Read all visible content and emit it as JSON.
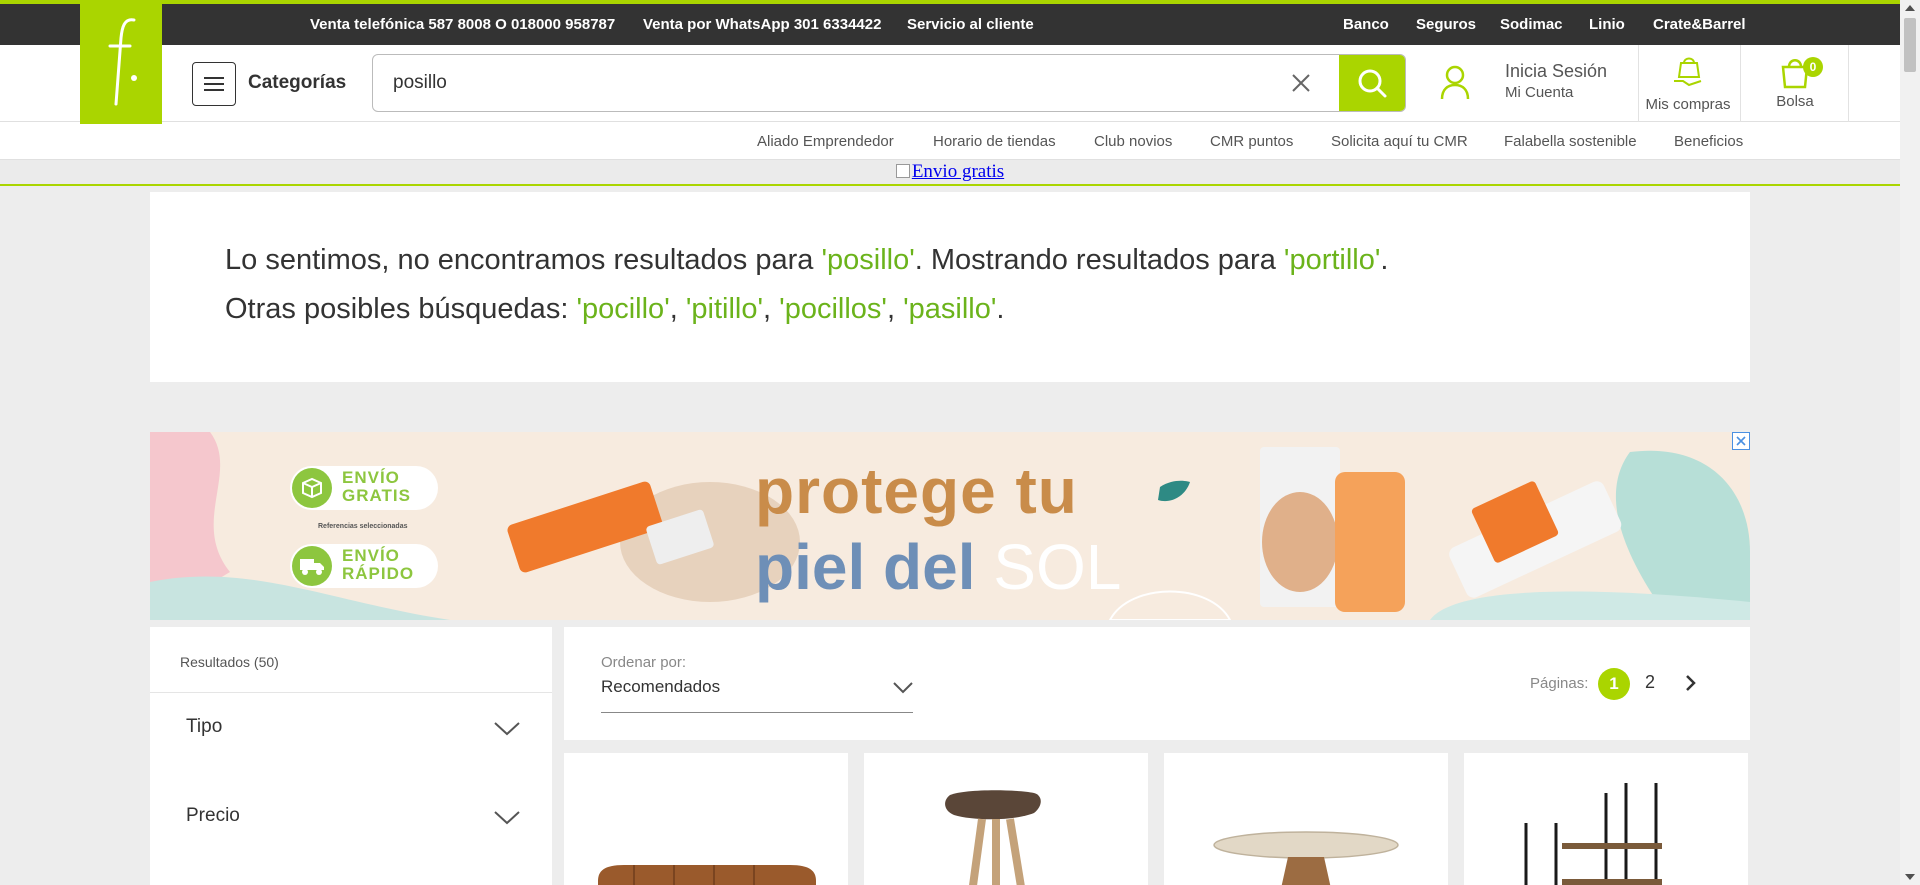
{
  "topbar": {
    "phone": "Venta telefónica 587 8008 O 018000 958787",
    "whatsapp": "Venta por WhatsApp 301 6334422",
    "service": "Servicio al cliente",
    "links": [
      "Banco",
      "Seguros",
      "Sodimac",
      "Linio",
      "Crate&Barrel"
    ]
  },
  "header": {
    "categories_label": "Categorías",
    "search_value": "posillo",
    "account_title": "Inicia Sesión",
    "account_sub": "Mi Cuenta",
    "purchases_label": "Mis compras",
    "bag_label": "Bolsa",
    "bag_count": "0"
  },
  "subnav": [
    "Aliado Emprendedor",
    "Horario de tiendas",
    "Club novios",
    "CMR puntos",
    "Solicita aquí tu CMR",
    "Falabella sostenible",
    "Beneficios"
  ],
  "strip": {
    "link": "Envio gratis"
  },
  "message": {
    "line1_a": "Lo sentimos, no encontramos resultados para ",
    "line1_term": "'posillo'",
    "line1_b": ".  Mostrando resultados para ",
    "line1_alt": "'portillo'",
    "line1_end": ".",
    "line2_a": "Otras posibles búsquedas: ",
    "suggestions": [
      "'pocillo'",
      "'pitillo'",
      "'pocillos'",
      "'pasillo'"
    ]
  },
  "banner": {
    "line1": "protege tu",
    "line2a": "piel del ",
    "line2b": "SOL",
    "badge1": [
      "ENVÍO",
      "GRATIS"
    ],
    "badge_note": "Referencias seleccionadas",
    "badge2": [
      "ENVÍO",
      "RÁPIDO"
    ]
  },
  "filters": {
    "results": "Resultados (50)",
    "items": [
      "Tipo",
      "Precio"
    ]
  },
  "sort": {
    "label": "Ordenar por:",
    "value": "Recomendados",
    "pages_label": "Páginas:",
    "pages": [
      "1",
      "2"
    ]
  },
  "colors": {
    "accent": "#aad500",
    "topbar": "#333333",
    "suggestion": "#6bb31b"
  }
}
